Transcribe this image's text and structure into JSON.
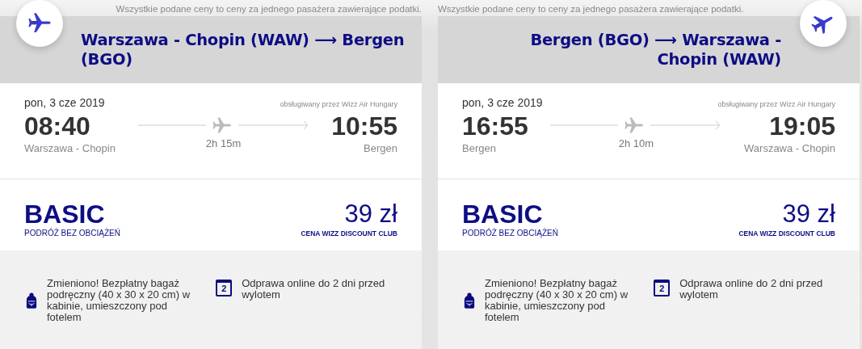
{
  "panels": [
    {
      "kind": "outbound",
      "notice": "Wszystkie podane ceny to ceny za jednego pasażera zawierające podatki.",
      "route": "Warszawa - Chopin (WAW) ⟶ Bergen (BGO)",
      "date": "pon, 3 cze 2019",
      "operator": "obsługiwany przez Wizz Air Hungary",
      "departure_time": "08:40",
      "departure_city": "Warszawa - Chopin",
      "duration": "2h 15m",
      "arrival_time": "10:55",
      "arrival_city": "Bergen",
      "fare": "BASIC",
      "fare_subtitle": "PODRÓŻ BEZ OBCIĄŻEŃ",
      "price": "39 zł",
      "price_note": "CENA WIZZ DISCOUNT CLUB",
      "features": [
        {
          "kind": "bag",
          "text": "Zmieniono! Bezpłatny bagaż podręczny (40 x 30 x 20 cm) w kabinie, umieszczony pod fotelem"
        },
        {
          "kind": "calendar",
          "icon_text": "2",
          "text": "Odprawa online do 2 dni przed wylotem"
        }
      ]
    },
    {
      "kind": "return",
      "notice": "Wszystkie podane ceny to ceny za jednego pasażera zawierające podatki.",
      "route": "Bergen (BGO) ⟶ Warszawa - Chopin (WAW)",
      "date": "pon, 3 cze 2019",
      "operator": "obsługiwany przez Wizz Air Hungary",
      "departure_time": "16:55",
      "departure_city": "Bergen",
      "duration": "2h 10m",
      "arrival_time": "19:05",
      "arrival_city": "Warszawa - Chopin",
      "fare": "BASIC",
      "fare_subtitle": "PODRÓŻ BEZ OBCIĄŻEŃ",
      "price": "39 zł",
      "price_note": "CENA WIZZ DISCOUNT CLUB",
      "features": [
        {
          "kind": "bag",
          "text": "Zmieniono! Bezpłatny bagaż podręczny (40 x 30 x 20 cm) w kabinie, umieszczony pod fotelem"
        },
        {
          "kind": "calendar",
          "icon_text": "2",
          "text": "Odprawa online do 2 dni przed wylotem"
        }
      ]
    }
  ]
}
